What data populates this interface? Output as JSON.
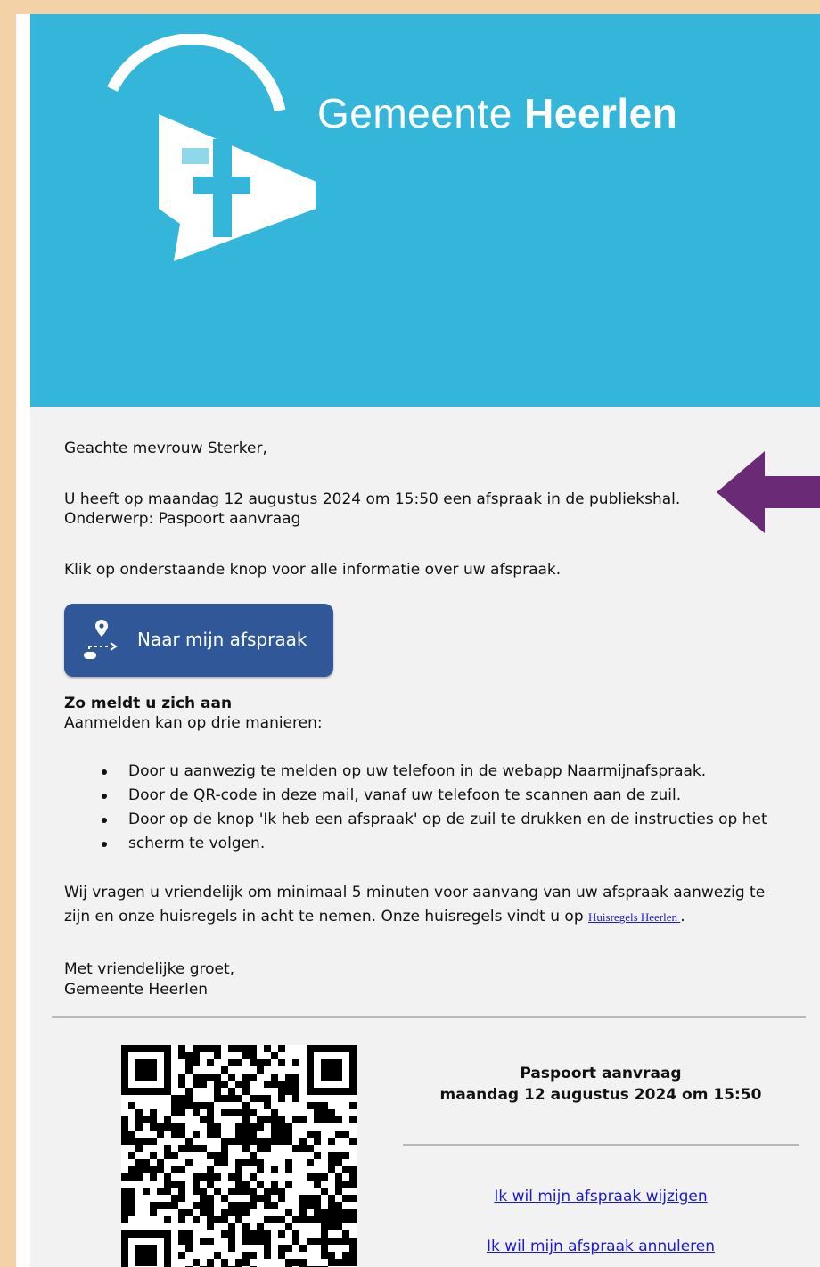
{
  "header": {
    "brand_light": "Gemeente",
    "brand_bold": "Heerlen",
    "banner_color": "#33b6d9"
  },
  "email": {
    "greeting": "Geachte mevrouw Sterker,",
    "appointment_line": "U heeft op maandag 12 augustus 2024 om 15:50 een afspraak in de publiekshal.",
    "subject_line": "Onderwerp: Paspoort aanvraag",
    "info_line": "Klik op onderstaande knop voor alle informatie over uw afspraak.",
    "button_label": "Naar mijn afspraak",
    "signin_heading": "Zo meldt u zich aan",
    "signin_intro": "Aanmelden kan op drie manieren:",
    "ways": [
      "Door u aanwezig te melden op uw telefoon in de webapp Naarmijnafspraak.",
      "Door de QR-code in deze mail, vanaf uw telefoon te scannen aan de zuil.",
      "Door op de knop 'Ik heb een afspraak' op de zuil te drukken en de instructies op het",
      "scherm te volgen."
    ],
    "request_line1": "Wij vragen u vriendelijk om minimaal 5 minuten voor aanvang van uw afspraak aanwezig te",
    "request_line2": "zijn en onze huisregels in acht te nemen. Onze huisregels vindt u op ",
    "house_rules_link": "Huisregels Heerlen ",
    "request_end": ".",
    "closing": "Met vriendelijke groet,",
    "signature": "Gemeente Heerlen"
  },
  "footer": {
    "appointment_type": "Paspoort aanvraag",
    "appointment_datetime": "maandag 12 augustus 2024 om 15:50",
    "change_link": "Ik wil mijn afspraak wijzigen",
    "cancel_link": "Ik wil mijn afspraak annuleren"
  },
  "colors": {
    "button": "#305898",
    "arrow": "#6b2a76",
    "link": "#1a1ad6",
    "frame": "#f3d2a8"
  }
}
